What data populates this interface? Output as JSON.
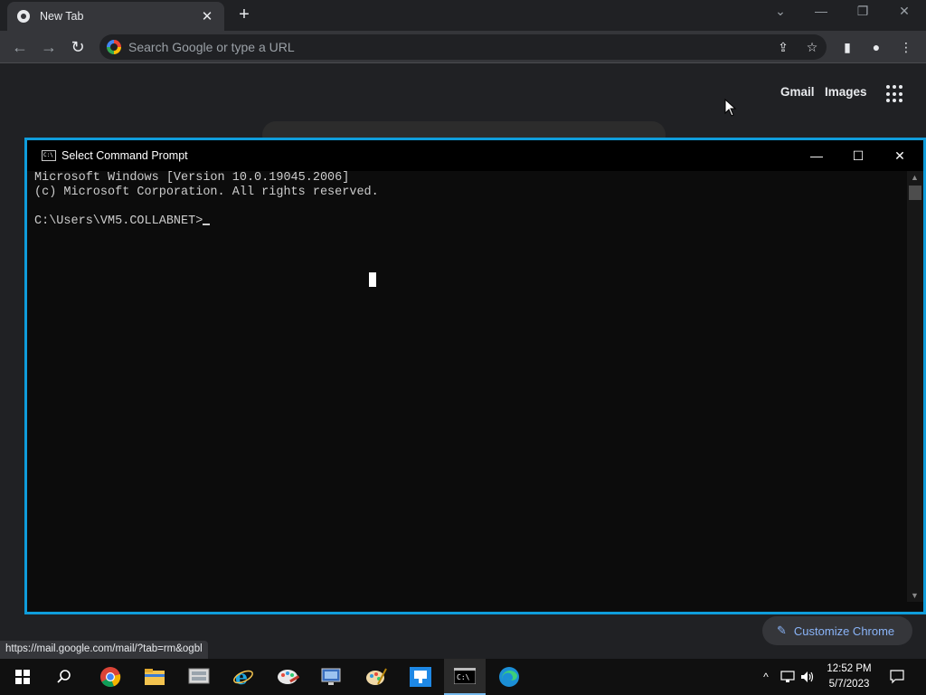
{
  "browser": {
    "tab_title": "New Tab",
    "omnibox_placeholder": "Search Google or type a URL",
    "ntp_links": {
      "gmail": "Gmail",
      "images": "Images"
    },
    "customize_label": "Customize Chrome",
    "status_url": "https://mail.google.com/mail/?tab=rm&ogbl"
  },
  "cmd": {
    "title": "Select Command Prompt",
    "lines": [
      "Microsoft Windows [Version 10.0.19045.2006]",
      "(c) Microsoft Corporation. All rights reserved.",
      "",
      "C:\\Users\\VM5.COLLABNET>"
    ]
  },
  "taskbar": {
    "time": "12:52 PM",
    "date": "5/7/2023",
    "apps": [
      "start",
      "search",
      "chrome",
      "file-explorer",
      "server-manager",
      "internet-explorer",
      "paint",
      "remote-desktop",
      "paint-tool",
      "network-app",
      "command-prompt",
      "edge"
    ]
  },
  "colors": {
    "accent": "#0f9ddb",
    "link": "#8ab4f8"
  }
}
